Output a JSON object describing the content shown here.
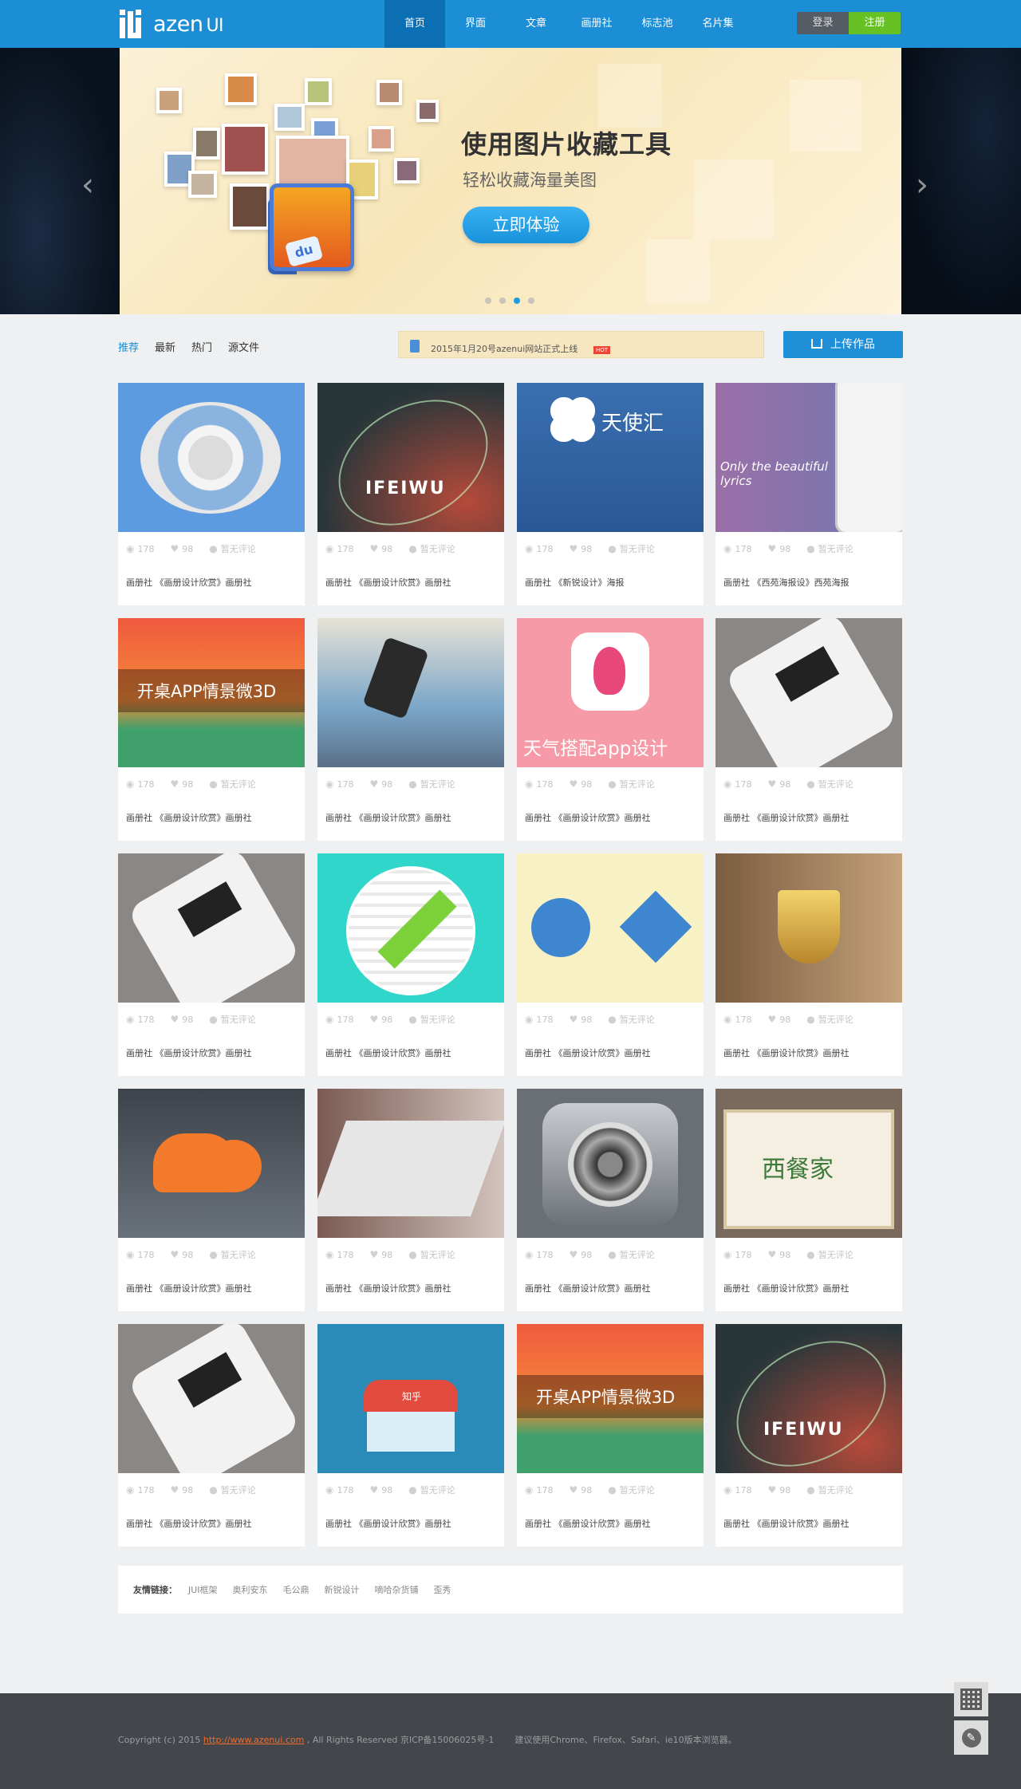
{
  "header": {
    "logo_text": "azen",
    "logo_suffix": "UI",
    "nav": [
      "首页",
      "界面",
      "文章",
      "画册社",
      "标志池",
      "名片集"
    ],
    "login": "登录",
    "register": "注册"
  },
  "banner": {
    "title": "使用图片收藏工具",
    "subtitle": "轻松收藏海量美图",
    "button": "立即体验",
    "app_tag": "du",
    "prev_arrow": "‹",
    "next_arrow": "›",
    "active_dot": 3
  },
  "toolbar": {
    "tabs": [
      "推荐",
      "最新",
      "热门",
      "源文件"
    ],
    "notice": "2015年1月20号azenui网站正式上线",
    "notice_badge": "HOT",
    "upload": "上传作品"
  },
  "card_stats": {
    "views": "178",
    "likes": "98",
    "comments": "暂无评论"
  },
  "cards": [
    {
      "caption": "画册社 《画册设计欣赏》画册社",
      "thumb_text": ""
    },
    {
      "caption": "画册社 《画册设计欣赏》画册社",
      "thumb_text": "IFEIWU"
    },
    {
      "caption": "画册社 《新锐设计》海报",
      "thumb_text": "天使汇"
    },
    {
      "caption": "画册社 《西苑海报设》西苑海报",
      "thumb_text": "Only the beautiful lyrics"
    },
    {
      "caption": "画册社 《画册设计欣赏》画册社",
      "thumb_text": "开桌APP情景微3D"
    },
    {
      "caption": "画册社 《画册设计欣赏》画册社",
      "thumb_text": ""
    },
    {
      "caption": "画册社 《画册设计欣赏》画册社",
      "thumb_text": "天气搭配app设计"
    },
    {
      "caption": "画册社 《画册设计欣赏》画册社",
      "thumb_text": ""
    },
    {
      "caption": "画册社 《画册设计欣赏》画册社",
      "thumb_text": ""
    },
    {
      "caption": "画册社 《画册设计欣赏》画册社",
      "thumb_text": ""
    },
    {
      "caption": "画册社 《画册设计欣赏》画册社",
      "thumb_text": ""
    },
    {
      "caption": "画册社 《画册设计欣赏》画册社",
      "thumb_text": ""
    },
    {
      "caption": "画册社 《画册设计欣赏》画册社",
      "thumb_text": ""
    },
    {
      "caption": "画册社 《画册设计欣赏》画册社",
      "thumb_text": ""
    },
    {
      "caption": "画册社 《画册设计欣赏》画册社",
      "thumb_text": ""
    },
    {
      "caption": "画册社 《画册设计欣赏》画册社",
      "thumb_text": "西餐家"
    },
    {
      "caption": "画册社 《画册设计欣赏》画册社",
      "thumb_text": ""
    },
    {
      "caption": "画册社 《画册设计欣赏》画册社",
      "thumb_text": "知乎"
    },
    {
      "caption": "画册社 《画册设计欣赏》画册社",
      "thumb_text": "开桌APP情景微3D"
    },
    {
      "caption": "画册社 《画册设计欣赏》画册社",
      "thumb_text": "IFEIWU"
    }
  ],
  "friends": {
    "label": "友情链接：",
    "links": [
      "JUI框架",
      "奥利安东",
      "毛公鼎",
      "新锐设计",
      "嘀哈杂货铺",
      "歪秀"
    ]
  },
  "footer": {
    "copyright": "Copyright (c) 2015 ",
    "url": "http://www.azenui.com",
    "rights": " , All Rights Reserved 京ICP备15006025号-1",
    "browser_note": "建议使用Chrome、Firefox、Safari、ie10版本浏览器。"
  },
  "colors": {
    "brand": "#1b8ed6",
    "register": "#67c125",
    "footer_bg": "#43474c"
  }
}
